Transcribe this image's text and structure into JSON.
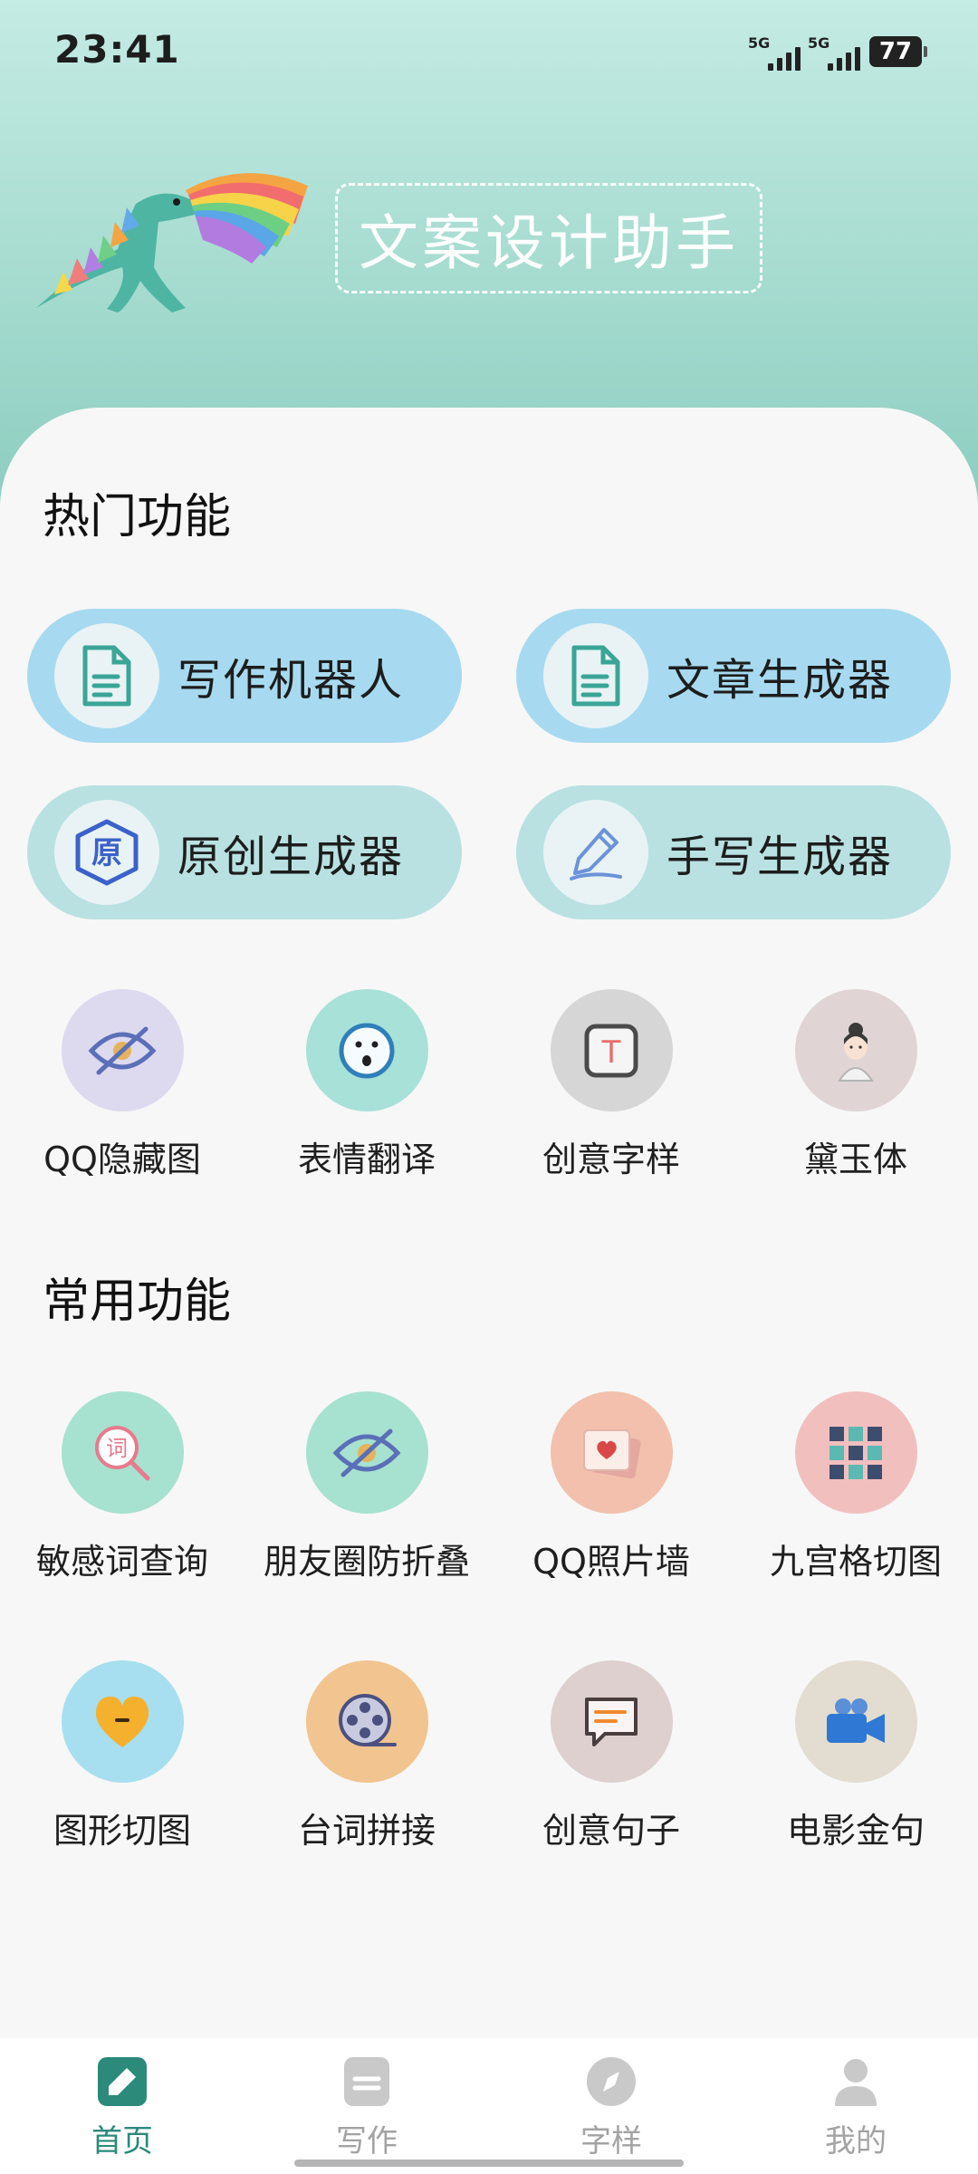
{
  "status_bar": {
    "time": "23:41",
    "network_1": "5G",
    "network_2": "5G",
    "battery": "77"
  },
  "header": {
    "title": "文案设计助手",
    "mascot_icon": "dinosaur-rainbow-icon"
  },
  "hot": {
    "title": "热门功能",
    "pills": [
      {
        "label": "写作机器人",
        "icon": "document-icon"
      },
      {
        "label": "文章生成器",
        "icon": "document-icon"
      },
      {
        "label": "原创生成器",
        "icon": "original-badge-icon",
        "badge_text": "原"
      },
      {
        "label": "手写生成器",
        "icon": "pen-icon"
      }
    ],
    "items": [
      {
        "label": "QQ隐藏图",
        "icon": "hidden-eye-icon"
      },
      {
        "label": "表情翻译",
        "icon": "emoji-face-icon"
      },
      {
        "label": "创意字样",
        "icon": "text-box-icon",
        "glyph": "T"
      },
      {
        "label": "黛玉体",
        "icon": "lady-portrait-icon"
      }
    ]
  },
  "common": {
    "title": "常用功能",
    "items": [
      {
        "label": "敏感词查询",
        "icon": "word-search-icon",
        "glyph": "词"
      },
      {
        "label": "朋友圈防折叠",
        "icon": "hidden-eye-icon"
      },
      {
        "label": "QQ照片墙",
        "icon": "photo-wall-icon"
      },
      {
        "label": "九宫格切图",
        "icon": "nine-grid-icon"
      },
      {
        "label": "图形切图",
        "icon": "heart-shape-icon"
      },
      {
        "label": "台词拼接",
        "icon": "film-reel-icon"
      },
      {
        "label": "创意句子",
        "icon": "chat-bubble-icon"
      },
      {
        "label": "电影金句",
        "icon": "video-camera-icon"
      }
    ]
  },
  "tabbar": {
    "tabs": [
      {
        "label": "首页",
        "icon": "home-edit-icon",
        "active": true
      },
      {
        "label": "写作",
        "icon": "write-icon",
        "active": false
      },
      {
        "label": "字样",
        "icon": "compass-icon",
        "active": false
      },
      {
        "label": "我的",
        "icon": "profile-icon",
        "active": false
      }
    ]
  },
  "colors": {
    "accent": "#2b8a7a",
    "hero_top": "#c4ebe4",
    "hero_bottom": "#86cabb",
    "pill_blue": "#a7daf0",
    "pill_teal": "#b9e1e2"
  }
}
